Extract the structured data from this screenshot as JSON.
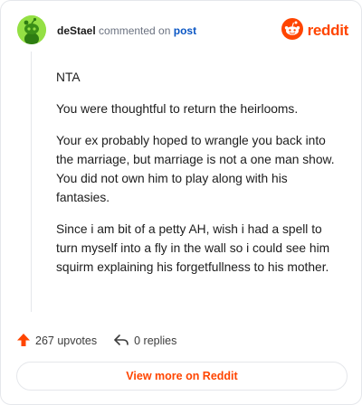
{
  "header": {
    "username": "deStael",
    "action_text": "commented on",
    "post_link": "post",
    "brand": "reddit"
  },
  "comment": {
    "paragraphs": [
      "NTA",
      "You were thoughtful to return the heirlooms.",
      "Your ex probably hoped to wrangle you back into the marriage, but marriage is not a one man show. You did not own him to play along with his fantasies.",
      "Since i am bit of a petty AH, wish i had a spell to turn myself into a fly in the wall so i could see him squirm explaining his forgetfullness to his mother."
    ]
  },
  "stats": {
    "upvotes": "267 upvotes",
    "replies": "0 replies"
  },
  "cta": {
    "label": "View more on Reddit"
  },
  "colors": {
    "brand": "#ff4500",
    "link": "#0a56c4",
    "avatar_bg": "#94e044"
  },
  "icons": {
    "avatar": "snoo-avatar-icon",
    "brand": "reddit-logo-icon",
    "upvote": "upvote-arrow-icon",
    "reply": "reply-arrow-icon"
  }
}
